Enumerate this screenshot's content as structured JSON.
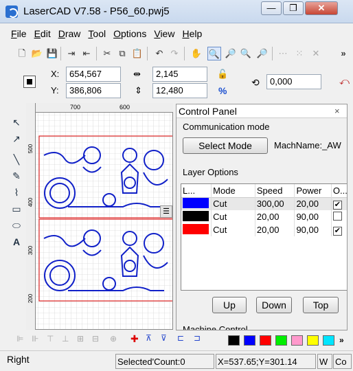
{
  "window": {
    "title": "LaserCAD V7.58  -  P56_60.pwj5",
    "minimize": "—",
    "restore": "❐",
    "close": "✕"
  },
  "menu": [
    {
      "letter": "F",
      "rest": "ile"
    },
    {
      "letter": "E",
      "rest": "dit"
    },
    {
      "letter": "D",
      "rest": "raw"
    },
    {
      "letter": "T",
      "rest": "ool"
    },
    {
      "letter": "O",
      "rest": "ptions"
    },
    {
      "letter": "V",
      "rest": "iew"
    },
    {
      "letter": "H",
      "rest": "elp"
    }
  ],
  "toolbar": {
    "icons": [
      "new-file-icon",
      "open-folder-icon",
      "save-icon",
      "import-icon",
      "export-icon",
      "cut-icon",
      "copy-icon",
      "paste-icon",
      "undo-icon",
      "redo-icon",
      "pan-hand-icon",
      "zoom-in-icon",
      "zoom-icon",
      "zoom-fit-icon",
      "zoom-window-icon",
      "group-icon",
      "ungroup-icon",
      "delete-icon"
    ],
    "overflow": "»"
  },
  "coords": {
    "x_label": "X:",
    "x_value": "654,567",
    "y_label": "Y:",
    "y_value": "386,806",
    "w_value": "2,145",
    "h_value": "12,480",
    "percent": "%",
    "rotate_value": "0,000"
  },
  "ruler": {
    "top_ticks": [
      "700",
      "600"
    ],
    "left_ticks": [
      "500",
      "400",
      "300",
      "200"
    ]
  },
  "control_panel": {
    "title": "Control Panel",
    "close": "×",
    "communication": {
      "title": "Communication mode",
      "select_button": "Select Mode",
      "machine_name": "MachName:_AW"
    },
    "layer_options": {
      "title": "Layer Options",
      "headers": [
        "L...",
        "Mode",
        "Speed",
        "Power",
        "O..."
      ],
      "rows": [
        {
          "color": "#0000ff",
          "mode": "Cut",
          "speed": "300,00",
          "power": "20,00",
          "output": true
        },
        {
          "color": "#000000",
          "mode": "Cut",
          "speed": "20,00",
          "power": "90,00",
          "output": false
        },
        {
          "color": "#ff0000",
          "mode": "Cut",
          "speed": "20,00",
          "power": "90,00",
          "output": true
        }
      ],
      "up": "Up",
      "down": "Down",
      "top": "Top"
    },
    "machine_control": "Machine Control"
  },
  "palette": [
    "#000000",
    "#0000ff",
    "#ff0000",
    "#00ee00",
    "#ff99cc",
    "#ffff00",
    "#00e5ff"
  ],
  "status": {
    "mode": "Right",
    "selected": "Selected'Count:0",
    "position": "X=537.65;Y=301.14",
    "w": "W",
    "co": "Co"
  }
}
